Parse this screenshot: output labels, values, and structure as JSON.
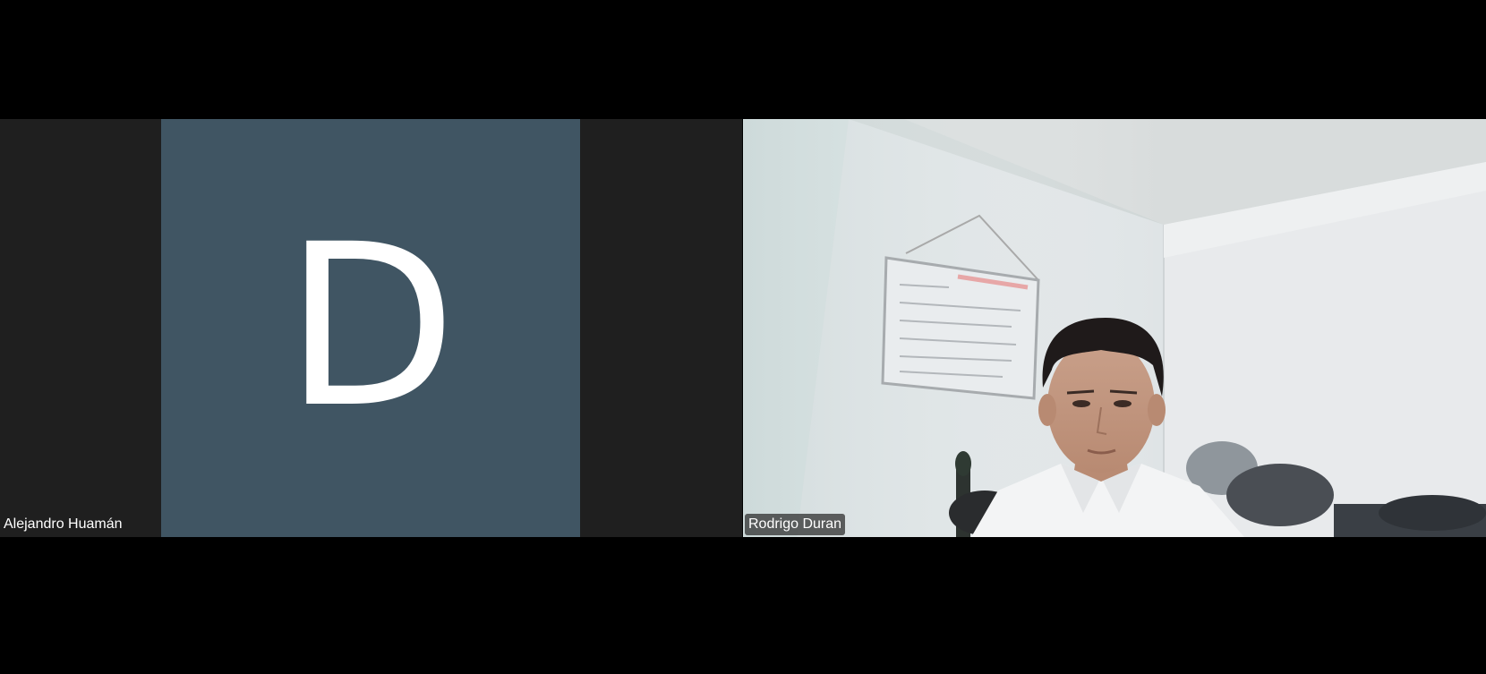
{
  "meeting": {
    "participants": [
      {
        "name": "Alejandro Huamán",
        "avatar_initial": "D",
        "video_on": false,
        "avatar_color": "#405563"
      },
      {
        "name": "Rodrigo Duran",
        "video_on": true
      }
    ]
  },
  "colors": {
    "background": "#000000",
    "tile_background": "#1f1f1f",
    "avatar_background": "#405563",
    "name_tag_text": "#ffffff"
  },
  "icons": {
    "avatar": "letter-avatar",
    "camera_feed": "webcam-video"
  }
}
